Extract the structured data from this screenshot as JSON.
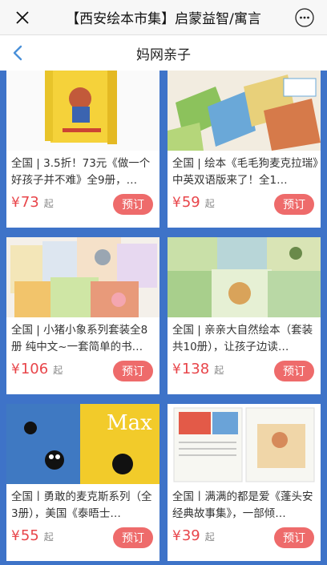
{
  "topbar": {
    "title": "【西安绘本市集】启蒙益智/寓言",
    "close_icon": "close-icon",
    "more_icon": "more-icon"
  },
  "header": {
    "title": "妈网亲子",
    "back_icon": "back-arrow-icon"
  },
  "colors": {
    "background": "#3e73c8",
    "price": "#e8454a",
    "button": "#ee6b6b"
  },
  "products": [
    {
      "desc": "全国 | 3.5折！73元《做一个好孩子并不难》全9册，…",
      "currency": "¥",
      "price": "73",
      "unit": "起",
      "button": "预订"
    },
    {
      "desc": "全国 | 绘本《毛毛狗麦克拉瑞》中英双语版来了！全1…",
      "currency": "¥",
      "price": "59",
      "unit": "起",
      "button": "预订"
    },
    {
      "desc": "全国 | 小猪小象系列套装全8册 纯中文~一套简单的书…",
      "currency": "¥",
      "price": "106",
      "unit": "起",
      "button": "预订"
    },
    {
      "desc": "全国 | 亲亲大自然绘本（套装共10册），让孩子边读…",
      "currency": "¥",
      "price": "138",
      "unit": "起",
      "button": "预订"
    },
    {
      "desc": "全国丨勇敢的麦克斯系列（全3册），美国《泰晤士…",
      "currency": "¥",
      "price": "55",
      "unit": "起",
      "button": "预订"
    },
    {
      "desc": "全国丨满满的都是爱《蓬头安经典故事集》，一部倾…",
      "currency": "¥",
      "price": "39",
      "unit": "起",
      "button": "预订"
    }
  ]
}
